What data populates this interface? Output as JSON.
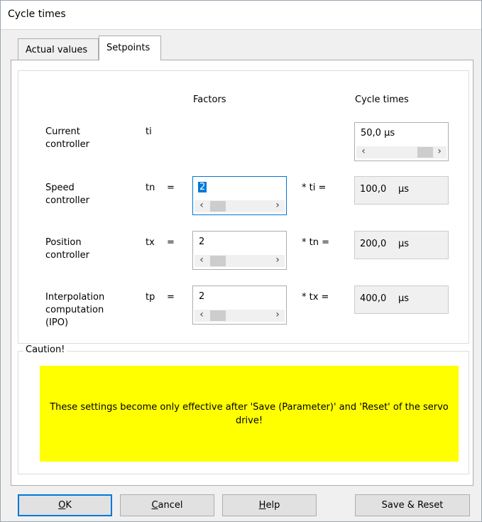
{
  "window": {
    "title": "Cycle times"
  },
  "tabs": [
    {
      "label": "Actual values",
      "active": false
    },
    {
      "label": "Setpoints",
      "active": true
    }
  ],
  "headers": {
    "factors": "Factors",
    "cycle_times": "Cycle times"
  },
  "rows": {
    "current": {
      "label": "Current\ncontroller",
      "symbol": "ti",
      "cycle": "50,0 µs"
    },
    "speed": {
      "label": "Speed\ncontroller",
      "symbol": "tn",
      "eq": "=",
      "factor": "2",
      "mult": "* ti =",
      "cycle_value": "100,0",
      "cycle_unit": "µs"
    },
    "position": {
      "label": "Position\ncontroller",
      "symbol": "tx",
      "eq": "=",
      "factor": "2",
      "mult": "* tn =",
      "cycle_value": "200,0",
      "cycle_unit": "µs"
    },
    "ipo": {
      "label": "Interpolation\ncomputation\n(IPO)",
      "symbol": "tp",
      "eq": "=",
      "factor": "2",
      "mult": "* tx =",
      "cycle_value": "400,0",
      "cycle_unit": "µs"
    }
  },
  "caution": {
    "legend": "Caution!",
    "text": "These settings become only effective after 'Save (Parameter)' and 'Reset' of the servo drive!"
  },
  "buttons": {
    "ok": {
      "mnemonic": "O",
      "rest": "K"
    },
    "cancel": {
      "mnemonic": "C",
      "rest": "ancel"
    },
    "help": {
      "mnemonic": "H",
      "rest": "elp"
    },
    "save_reset": "Save & Reset"
  },
  "icons": {
    "left_arrow": "‹",
    "right_arrow": "›"
  },
  "colors": {
    "accent": "#0078d7",
    "caution_bg": "#ffff00"
  }
}
